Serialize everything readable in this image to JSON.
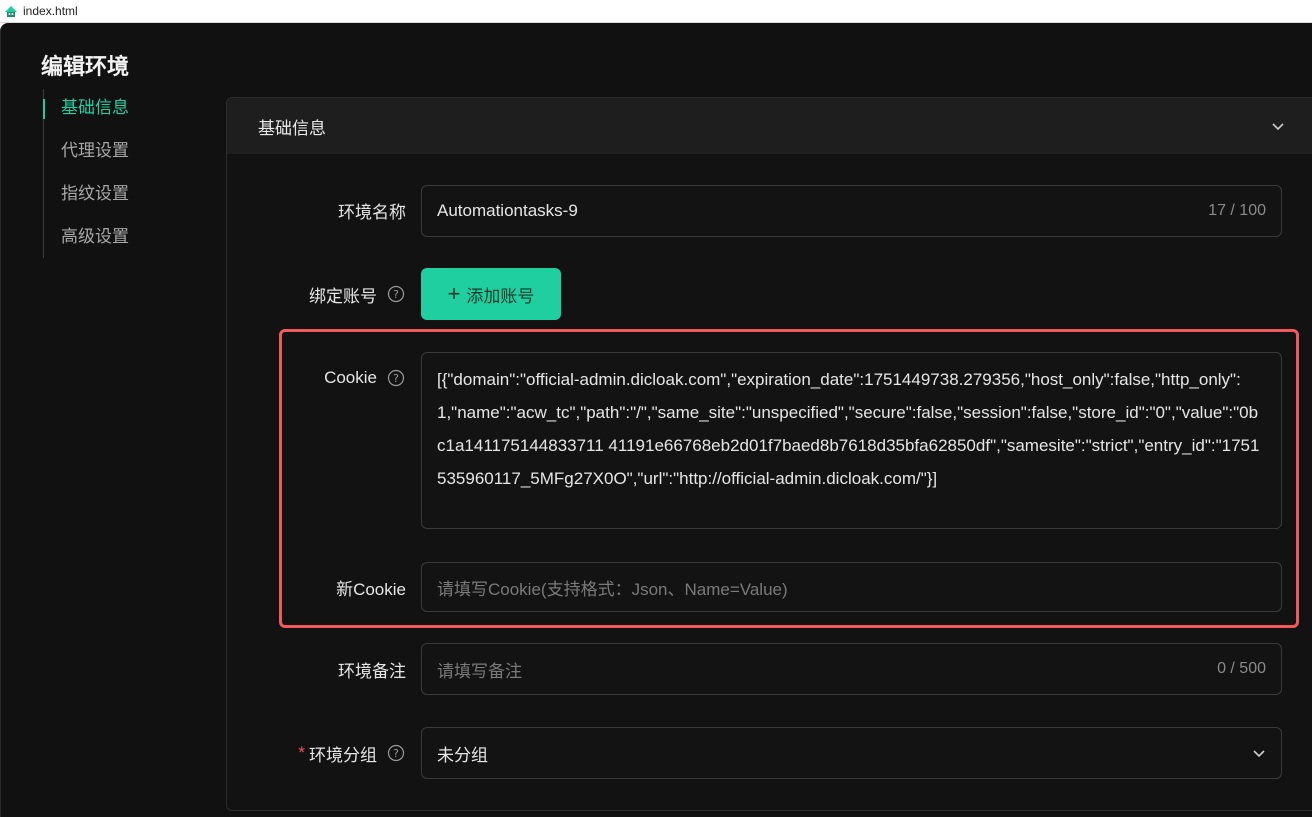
{
  "window": {
    "title": "index.html"
  },
  "page": {
    "title": "编辑环境"
  },
  "nav": {
    "items": [
      {
        "label": "基础信息"
      },
      {
        "label": "代理设置"
      },
      {
        "label": "指纹设置"
      },
      {
        "label": "高级设置"
      }
    ]
  },
  "section": {
    "title": "基础信息"
  },
  "form": {
    "env_name": {
      "label": "环境名称",
      "value": "Automationtasks-9",
      "count": "17 / 100"
    },
    "bind_account": {
      "label": "绑定账号",
      "button_label": "添加账号"
    },
    "cookie": {
      "label": "Cookie",
      "value": "[{\"domain\":\"official-admin.dicloak.com\",\"expiration_date\":1751449738.279356,\"host_only\":false,\"http_only\":1,\"name\":\"acw_tc\",\"path\":\"/\",\"same_site\":\"unspecified\",\"secure\":false,\"session\":false,\"store_id\":\"0\",\"value\":\"0bc1a141175144833711 41191e66768eb2d01f7baed8b7618d35bfa62850df\",\"samesite\":\"strict\",\"entry_id\":\"1751535960117_5MFg27X0O\",\"url\":\"http://official-admin.dicloak.com/\"}]"
    },
    "new_cookie": {
      "label": "新Cookie",
      "placeholder": "请填写Cookie(支持格式：Json、Name=Value)"
    },
    "remark": {
      "label": "环境备注",
      "placeholder": "请填写备注",
      "count": "0 / 500"
    },
    "group": {
      "label": "环境分组",
      "required_mark": "*",
      "value": "未分组"
    }
  },
  "colors": {
    "accent": "#1ecf9f",
    "highlight": "#f05a5f",
    "background": "#111111"
  }
}
